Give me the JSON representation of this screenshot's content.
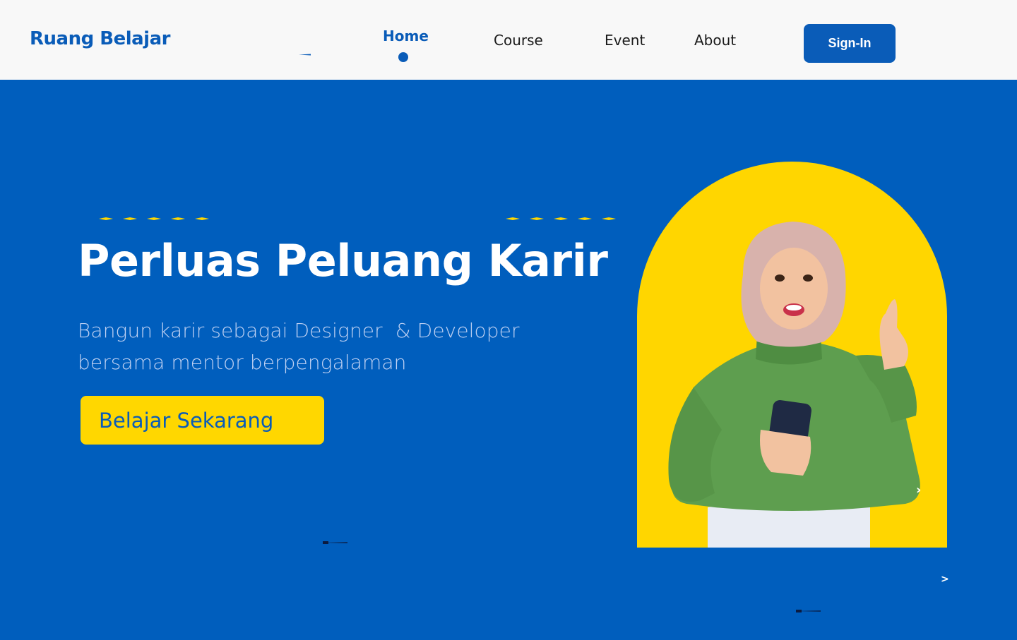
{
  "brand": {
    "name": "Ruang Belajar"
  },
  "nav": {
    "items": [
      {
        "label": "Home",
        "active": true
      },
      {
        "label": "Course",
        "active": false
      },
      {
        "label": "Event",
        "active": false
      },
      {
        "label": "About",
        "active": false
      }
    ],
    "signin_label": "Sign-In"
  },
  "hero": {
    "title": "Perluas Peluang Karir",
    "subtitle_line1": "Bangun karir sebagai Designer  & Developer",
    "subtitle_line2": "bersama mentor berpengalaman",
    "cta_label": "Belajar Sekarang"
  },
  "colors": {
    "primary_blue": "#005EBD",
    "brand_blue": "#0A5CB8",
    "yellow": "#FFD700",
    "nav_bg": "#F8F8F8",
    "white": "#FFFFFF"
  },
  "icons": {
    "nav_active_indicator": "dot",
    "carousel_next": "chevron-right-icon",
    "decorative_stars": "star-row"
  }
}
